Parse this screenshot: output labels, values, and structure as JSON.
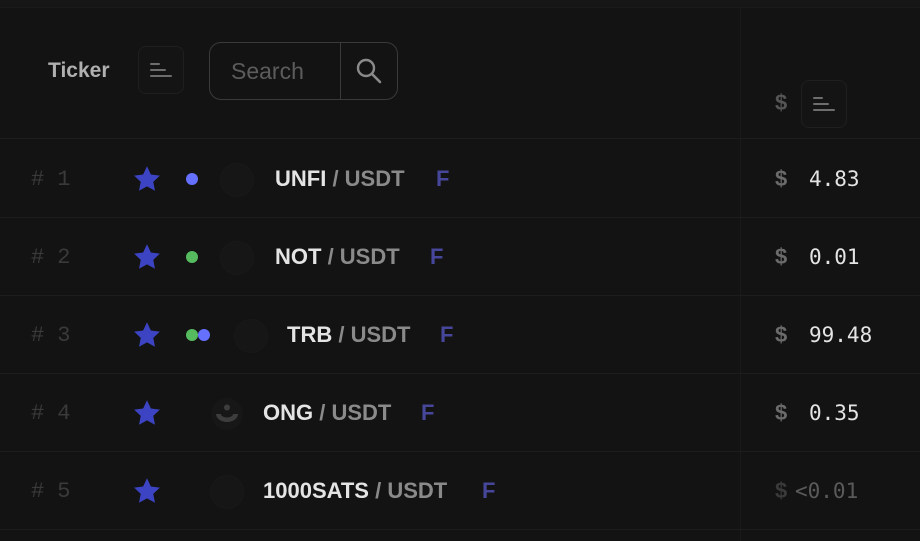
{
  "header": {
    "ticker_label": "Ticker",
    "ticker_sort_icon": "sort-lines-icon",
    "search": {
      "placeholder": "Search",
      "value": "",
      "icon": "search-icon"
    },
    "price_currency_symbol": "$",
    "price_sort_icon": "sort-lines-icon"
  },
  "colors": {
    "favorite_star": "#3c44c4",
    "futures_badge": "#46469a",
    "dot_blue": "#6670ff",
    "dot_green": "#55bb5e"
  },
  "rows": [
    {
      "rank_prefix": "#",
      "rank": "1",
      "favorite": true,
      "dots": [
        "blue"
      ],
      "coin_icon": "coin-logo-icon",
      "base": "UNFI",
      "separator": " / ",
      "quote": "USDT",
      "badge": "F",
      "currency": "$",
      "price": "4.83"
    },
    {
      "rank_prefix": "#",
      "rank": "2",
      "favorite": true,
      "dots": [
        "green"
      ],
      "coin_icon": "coin-logo-icon",
      "base": "NOT",
      "separator": " / ",
      "quote": "USDT",
      "badge": "F",
      "currency": "$",
      "price": "0.01"
    },
    {
      "rank_prefix": "#",
      "rank": "3",
      "favorite": true,
      "dots": [
        "green",
        "blue"
      ],
      "coin_icon": "coin-logo-icon",
      "base": "TRB",
      "separator": " / ",
      "quote": "USDT",
      "badge": "F",
      "currency": "$",
      "price": "99.48"
    },
    {
      "rank_prefix": "#",
      "rank": "4",
      "favorite": true,
      "dots": [],
      "coin_icon": "ong-logo-icon",
      "base": "ONG",
      "separator": " / ",
      "quote": "USDT",
      "badge": "F",
      "currency": "$",
      "price": "0.35"
    },
    {
      "rank_prefix": "#",
      "rank": "5",
      "favorite": true,
      "dots": [],
      "coin_icon": "coin-logo-icon",
      "base": "1000SATS",
      "separator": " / ",
      "quote": "USDT",
      "badge": "F",
      "currency": "$",
      "price": "<0.01"
    }
  ]
}
